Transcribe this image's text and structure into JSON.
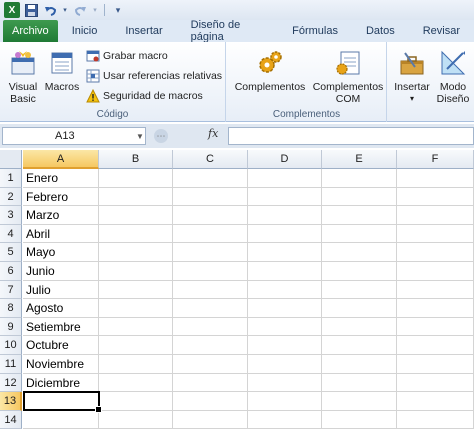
{
  "quick_access": {
    "app_icon": "excel-icon",
    "buttons": [
      "save-icon",
      "undo-icon",
      "redo-icon",
      "customize-icon"
    ]
  },
  "tabs": [
    {
      "label": "Archivo",
      "kind": "file"
    },
    {
      "label": "Inicio",
      "kind": "normal"
    },
    {
      "label": "Insertar",
      "kind": "normal"
    },
    {
      "label": "Diseño de página",
      "kind": "normal"
    },
    {
      "label": "Fórmulas",
      "kind": "normal"
    },
    {
      "label": "Datos",
      "kind": "normal"
    },
    {
      "label": "Revisar",
      "kind": "normal"
    }
  ],
  "ribbon": {
    "codigo": {
      "label": "Código",
      "visual_basic": "Visual Basic",
      "macros": "Macros",
      "grabar_macro": "Grabar macro",
      "usar_referencias": "Usar referencias relativas",
      "seguridad": "Seguridad de macros"
    },
    "complementos": {
      "label": "Complementos",
      "complementos_btn": "Complementos",
      "com_line1": "Complementos",
      "com_line2": "COM"
    },
    "controles": {
      "insertar": "Insertar",
      "modo_line1": "Modo",
      "modo_line2": "Diseño"
    }
  },
  "formula_bar": {
    "name_box": "A13",
    "fx": "fx",
    "formula": ""
  },
  "sheet": {
    "columns": [
      "A",
      "B",
      "C",
      "D",
      "E",
      "F"
    ],
    "rows": [
      {
        "num": "1",
        "a": "Enero"
      },
      {
        "num": "2",
        "a": "Febrero"
      },
      {
        "num": "3",
        "a": "Marzo"
      },
      {
        "num": "4",
        "a": "Abril"
      },
      {
        "num": "5",
        "a": "Mayo"
      },
      {
        "num": "6",
        "a": "Junio"
      },
      {
        "num": "7",
        "a": "Julio"
      },
      {
        "num": "8",
        "a": "Agosto"
      },
      {
        "num": "9",
        "a": "Setiembre"
      },
      {
        "num": "10",
        "a": "Octubre"
      },
      {
        "num": "11",
        "a": "Noviembre"
      },
      {
        "num": "12",
        "a": "Diciembre"
      },
      {
        "num": "13",
        "a": ""
      },
      {
        "num": "14",
        "a": ""
      }
    ],
    "active_cell": "A13",
    "selected_column": "A",
    "selected_row": "13"
  },
  "colors": {
    "file_tab": "#1f7a35",
    "selection_highlight": "#f6c862"
  }
}
